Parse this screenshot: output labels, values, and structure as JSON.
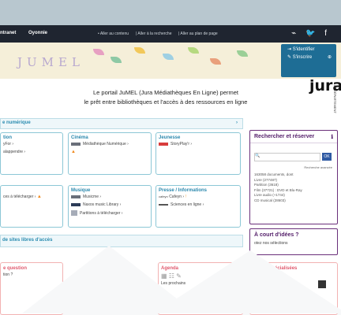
{
  "nav": {
    "left_items": [
      "ntranet",
      "Oyonnie"
    ],
    "skip_links": [
      "Aller au contenu",
      "Aller à la recherche",
      "Aller au plan de page"
    ],
    "social": [
      "rss",
      "twitter",
      "facebook"
    ]
  },
  "banner": {
    "logo_text": "JUMEL"
  },
  "account": {
    "login_label": "S'identifier",
    "register_label": "S'inscrire"
  },
  "intro": {
    "line1": "Le portail JuMEL (Jura Médiathèques En Ligne) permet",
    "line2": "le prêt entre bibliothèques et l'accès à des ressources en ligne"
  },
  "jura": {
    "brand": "jura",
    "subtitle": "LE DÉPARTEMENT"
  },
  "sections": {
    "numerique": "e numérique",
    "sites_libres": "de sites libres d'accès"
  },
  "boxes": {
    "formation": {
      "title": "tion",
      "items": [
        "yFor",
        "alappendre"
      ]
    },
    "cinema": {
      "title": "Cinéma",
      "items": [
        "Médiathèque Numérique"
      ]
    },
    "jeunesse": {
      "title": "Jeunesse",
      "items": [
        "StoryPlay'r"
      ]
    },
    "autres": {
      "title": "",
      "items": [
        "ces à télécharger"
      ]
    },
    "musique": {
      "title": "Musique",
      "items": [
        "Musicme",
        "Naxos music Library",
        "Partitions à télécharger"
      ]
    },
    "presse": {
      "title": "Presse / Informations",
      "items": [
        "Cafeyn",
        "Sciences en ligne"
      ]
    }
  },
  "search": {
    "title": "Rechercher et réserver",
    "ok_label": "OK",
    "advanced": "Recherche avancée",
    "stats": [
      "163058 documents, dont",
      "Livre (277487)",
      "Partition (3618)",
      "Film (37721) : DVD et Blu-Ray",
      "Livre audio (+1744)",
      "CD musical (28603)"
    ]
  },
  "ideas": {
    "title": "À court d'idées ?",
    "sub": "otez nos sélections"
  },
  "bottom": {
    "question": "e question",
    "question_sub": "tion ?",
    "agenda": "Agenda",
    "agenda_sub": "Les prochains",
    "specialisees": "spécialisées"
  }
}
